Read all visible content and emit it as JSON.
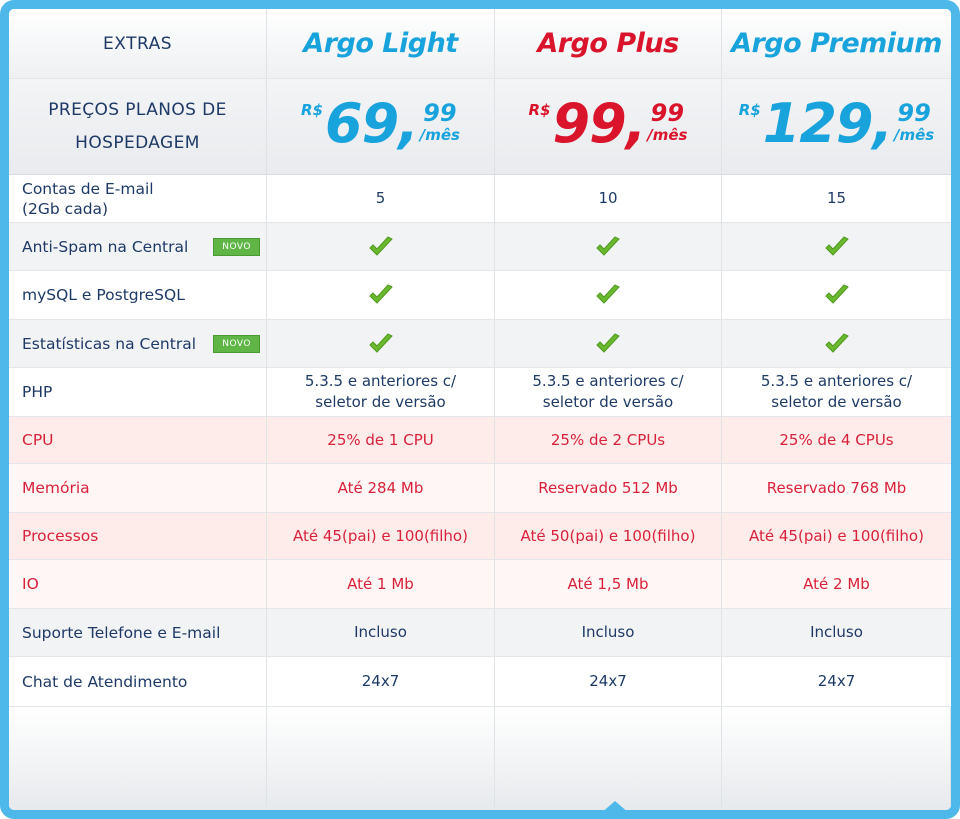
{
  "header": {
    "extras": "EXTRAS",
    "plans": [
      {
        "name": "Argo Light",
        "color": "#19a3dc"
      },
      {
        "name": "Argo Plus",
        "color": "#d9142b"
      },
      {
        "name": "Argo Premium",
        "color": "#19a3dc"
      }
    ]
  },
  "prices": {
    "label_line1": "PREÇOS PLANOS DE",
    "label_line2": "HOSPEDAGEM",
    "items": [
      {
        "currency": "R$",
        "integer": "69,",
        "cents": "99",
        "period": "/mês",
        "color": "#19a3dc"
      },
      {
        "currency": "R$",
        "integer": "99,",
        "cents": "99",
        "period": "/mês",
        "color": "#d9142b"
      },
      {
        "currency": "R$",
        "integer": "129,",
        "cents": "99",
        "period": "/mês",
        "color": "#19a3dc"
      }
    ]
  },
  "badge_text": "NOVO",
  "rows": [
    {
      "label_line1": "Contas de E-mail",
      "label_line2": "(2Gb cada)",
      "values": [
        "5",
        "10",
        "15"
      ]
    },
    {
      "label": "Anti-Spam na Central",
      "badge": true,
      "check": true
    },
    {
      "label": "mySQL e PostgreSQL",
      "check": true
    },
    {
      "label": "Estatísticas na Central",
      "badge": true,
      "check": true
    },
    {
      "label": "PHP",
      "values_line1": [
        "5.3.5 e anteriores c/",
        "5.3.5 e anteriores c/",
        "5.3.5 e anteriores c/"
      ],
      "values_line2": [
        "seletor de versão",
        "seletor de versão",
        "seletor de versão"
      ]
    },
    {
      "label": "CPU",
      "values": [
        "25% de 1 CPU",
        "25% de 2 CPUs",
        "25% de 4 CPUs"
      ]
    },
    {
      "label": "Memória",
      "values": [
        "Até 284 Mb",
        "Reservado 512 Mb",
        "Reservado 768 Mb"
      ]
    },
    {
      "label": "Processos",
      "values": [
        "Até 45(pai) e 100(filho)",
        "Até 50(pai) e 100(filho)",
        "Até 45(pai) e 100(filho)"
      ]
    },
    {
      "label": "IO",
      "values": [
        "Até 1 Mb",
        "Até 1,5 Mb",
        "Até 2 Mb"
      ]
    },
    {
      "label": "Suporte Telefone e E-mail",
      "values": [
        "Incluso",
        "Incluso",
        "Incluso"
      ]
    },
    {
      "label": "Chat de Atendimento",
      "values": [
        "24x7",
        "24x7",
        "24x7"
      ]
    }
  ],
  "colors": {
    "frame": "#4fb8ea",
    "text": "#1d3a66",
    "highlight_text": "#d9213a",
    "check": "#6ab82e",
    "badge": "#5fb545"
  },
  "icons": {
    "check": "check-icon"
  }
}
